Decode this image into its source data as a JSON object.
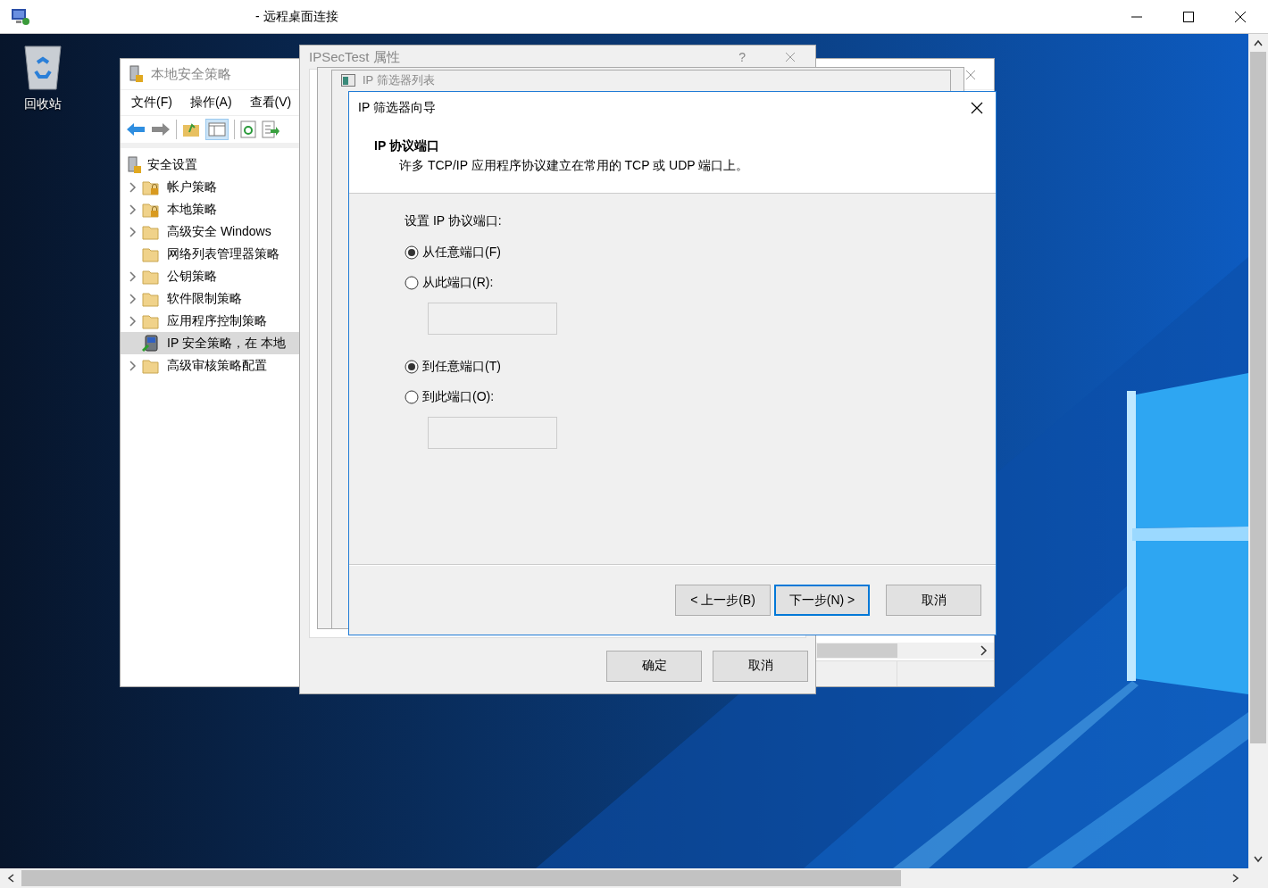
{
  "remote_window": {
    "title": "- 远程桌面连接"
  },
  "desktop": {
    "icons": [
      {
        "label": "回收站"
      }
    ]
  },
  "mmc": {
    "title": "本地安全策略",
    "menu": [
      "文件(F)",
      "操作(A)",
      "查看(V)"
    ],
    "tree": {
      "label": "安全设置",
      "children": [
        {
          "label": "帐户策略",
          "kind": "locked",
          "expandable": true,
          "selected": false
        },
        {
          "label": "本地策略",
          "kind": "locked",
          "expandable": true,
          "selected": false
        },
        {
          "label": "高级安全 Windows",
          "kind": "folder",
          "expandable": true,
          "selected": false
        },
        {
          "label": "网络列表管理器策略",
          "kind": "folder",
          "expandable": false,
          "selected": false
        },
        {
          "label": "公钥策略",
          "kind": "folder",
          "expandable": true,
          "selected": false
        },
        {
          "label": "软件限制策略",
          "kind": "folder",
          "expandable": true,
          "selected": false
        },
        {
          "label": "应用程序控制策略",
          "kind": "folder",
          "expandable": true,
          "selected": false
        },
        {
          "label": "IP 安全策略，在 本地",
          "kind": "ip",
          "expandable": false,
          "selected": true
        },
        {
          "label": "高级审核策略配置",
          "kind": "folder",
          "expandable": true,
          "selected": false
        }
      ]
    }
  },
  "properties_dialog": {
    "title": "IPSecTest 属性",
    "help": "?",
    "buttons": [
      "确定",
      "取消"
    ]
  },
  "filter_list_window": {
    "title": "IP 筛选器列表"
  },
  "wizard": {
    "title": "IP 筛选器向导",
    "heading": "IP 协议端口",
    "description": "许多 TCP/IP 应用程序协议建立在常用的 TCP 或 UDP 端口上。",
    "prompt": "设置 IP 协议端口:",
    "groups": [
      {
        "options": [
          {
            "label": "从任意端口(F)",
            "selected": true
          },
          {
            "label": "从此端口(R):",
            "selected": false
          }
        ]
      },
      {
        "options": [
          {
            "label": "到任意端口(T)",
            "selected": true
          },
          {
            "label": "到此端口(O):",
            "selected": false
          }
        ]
      }
    ],
    "buttons": [
      {
        "label": "< 上一步(B)",
        "focused": false
      },
      {
        "label": "下一步(N) >",
        "focused": true
      },
      {
        "label": "取消",
        "focused": false
      }
    ]
  }
}
